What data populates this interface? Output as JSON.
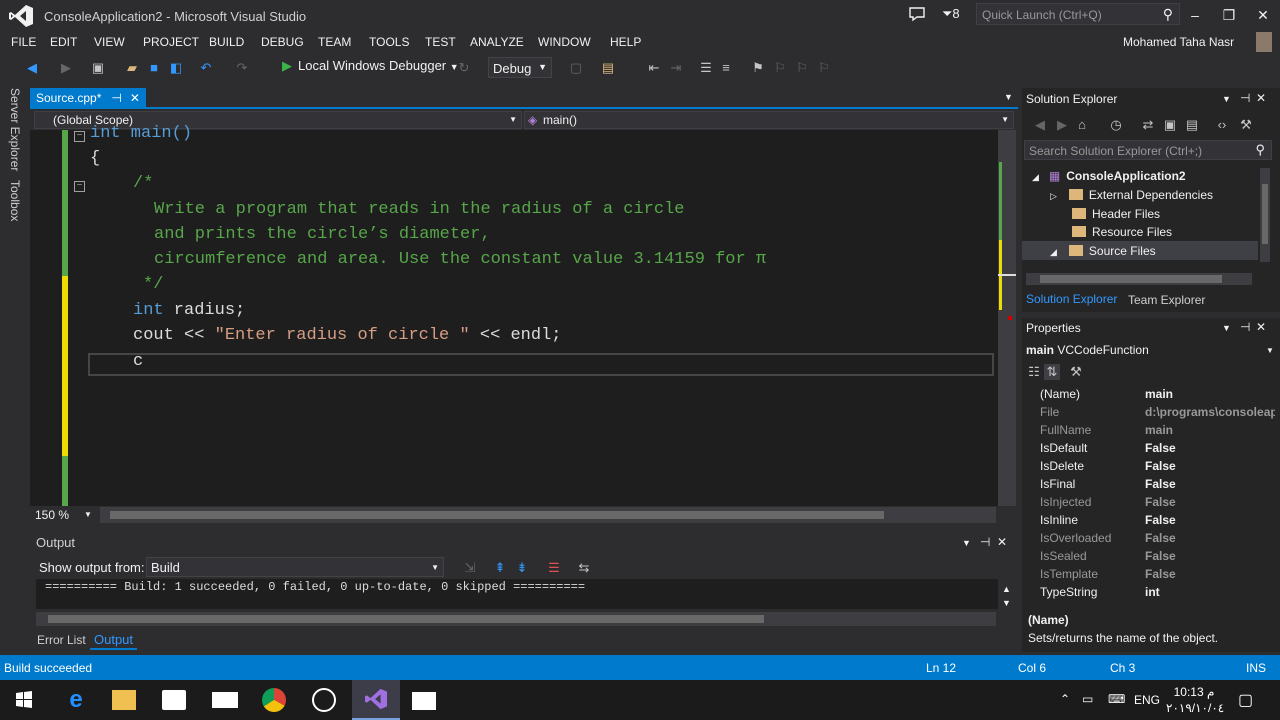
{
  "window": {
    "title": "ConsoleApplication2 - Microsoft Visual Studio",
    "notif_count": "8",
    "quick_launch_placeholder": "Quick Launch (Ctrl+Q)",
    "user": "Mohamed Taha Nasr"
  },
  "menu": [
    "FILE",
    "EDIT",
    "VIEW",
    "PROJECT",
    "BUILD",
    "DEBUG",
    "TEAM",
    "TOOLS",
    "TEST",
    "ANALYZE",
    "WINDOW",
    "HELP"
  ],
  "toolbar": {
    "run_label": "Local Windows Debugger",
    "config": "Debug"
  },
  "sidebar": {
    "server_explorer": "Server Explorer",
    "toolbox": "Toolbox"
  },
  "editor": {
    "tab": "Source.cpp*",
    "scope": "(Global Scope)",
    "member": "main()",
    "zoom": "150 %",
    "lines": {
      "l1": "int main()",
      "l2": "{",
      "l3": "/*",
      "l4": "Write a program that reads in the radius of a circle",
      "l5": "and prints the circle’s diameter,",
      "l6": "circumference and area. Use the constant value 3.14159 for π",
      "l7": "*/",
      "l8_kw": "int",
      "l8": " radius;",
      "l9a": "cout << ",
      "l9s": "\"Enter radius of circle \"",
      "l9b": " << endl;",
      "l10": "c"
    }
  },
  "output": {
    "title": "Output",
    "show_label": "Show output from:",
    "source": "Build",
    "text": "========== Build: 1 succeeded, 0 failed, 0 up-to-date, 0 skipped =========="
  },
  "bottom_tabs": {
    "error_list": "Error List",
    "output": "Output"
  },
  "solution_explorer": {
    "title": "Solution Explorer",
    "search_placeholder": "Search Solution Explorer (Ctrl+;)",
    "project": "ConsoleApplication2",
    "items": [
      "External Dependencies",
      "Header Files",
      "Resource Files",
      "Source Files"
    ],
    "tab_se": "Solution Explorer",
    "tab_te": "Team Explorer"
  },
  "properties": {
    "title": "Properties",
    "object": "main",
    "object_type": "VCCodeFunction",
    "rows": [
      {
        "name": "(Name)",
        "value": "main",
        "active": true
      },
      {
        "name": "File",
        "value": "d:\\programs\\consoleap",
        "active": false
      },
      {
        "name": "FullName",
        "value": "main",
        "active": false
      },
      {
        "name": "IsDefault",
        "value": "False",
        "active": true
      },
      {
        "name": "IsDelete",
        "value": "False",
        "active": true
      },
      {
        "name": "IsFinal",
        "value": "False",
        "active": true
      },
      {
        "name": "IsInjected",
        "value": "False",
        "active": false
      },
      {
        "name": "IsInline",
        "value": "False",
        "active": true
      },
      {
        "name": "IsOverloaded",
        "value": "False",
        "active": false
      },
      {
        "name": "IsSealed",
        "value": "False",
        "active": false
      },
      {
        "name": "IsTemplate",
        "value": "False",
        "active": false
      },
      {
        "name": "TypeString",
        "value": "int",
        "active": true
      }
    ],
    "desc_title": "(Name)",
    "desc_text": "Sets/returns the name of the object."
  },
  "status": {
    "message": "Build succeeded",
    "ln": "Ln 12",
    "col": "Col 6",
    "ch": "Ch 3",
    "mode": "INS"
  },
  "taskbar": {
    "lang": "ENG",
    "time": "10:13 م",
    "date": "٢٠١٩/١٠/٠٤"
  },
  "colors": {
    "accent": "#007acc",
    "comment": "#57a64a",
    "keyword": "#569cd6",
    "string": "#d69d85"
  }
}
